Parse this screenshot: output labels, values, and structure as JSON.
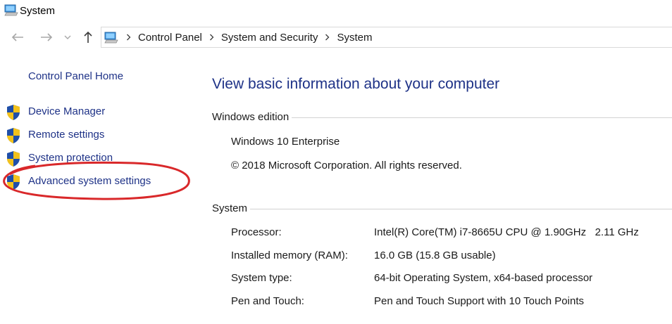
{
  "window": {
    "title": "System"
  },
  "nav": {
    "back_icon": "arrow-left-icon",
    "forward_icon": "arrow-right-icon",
    "recent_icon": "chevron-down-icon",
    "up_icon": "arrow-up-icon"
  },
  "breadcrumb": [
    "Control Panel",
    "System and Security",
    "System"
  ],
  "sidebar": {
    "home": "Control Panel Home",
    "items": [
      {
        "label": "Device Manager",
        "icon": "uac-shield-icon"
      },
      {
        "label": "Remote settings",
        "icon": "uac-shield-icon"
      },
      {
        "label": "System protection",
        "icon": "uac-shield-icon"
      },
      {
        "label": "Advanced system settings",
        "icon": "uac-shield-icon"
      }
    ]
  },
  "main": {
    "heading": "View basic information about your computer",
    "windows_edition": {
      "title": "Windows edition",
      "edition": "Windows 10 Enterprise",
      "copyright": "© 2018 Microsoft Corporation. All rights reserved."
    },
    "system": {
      "title": "System",
      "rows": [
        {
          "label": "Processor:",
          "value": "Intel(R) Core(TM) i7-8665U CPU @ 1.90GHz   2.11 GHz"
        },
        {
          "label": "Installed memory (RAM):",
          "value": "16.0 GB (15.8 GB usable)"
        },
        {
          "label": "System type:",
          "value": "64-bit Operating System, x64-based processor"
        },
        {
          "label": "Pen and Touch:",
          "value": "Pen and Touch Support with 10 Touch Points"
        }
      ]
    }
  },
  "colors": {
    "link": "#1e3287",
    "annotation": "#d9282a",
    "rule": "#d2d2d2"
  }
}
